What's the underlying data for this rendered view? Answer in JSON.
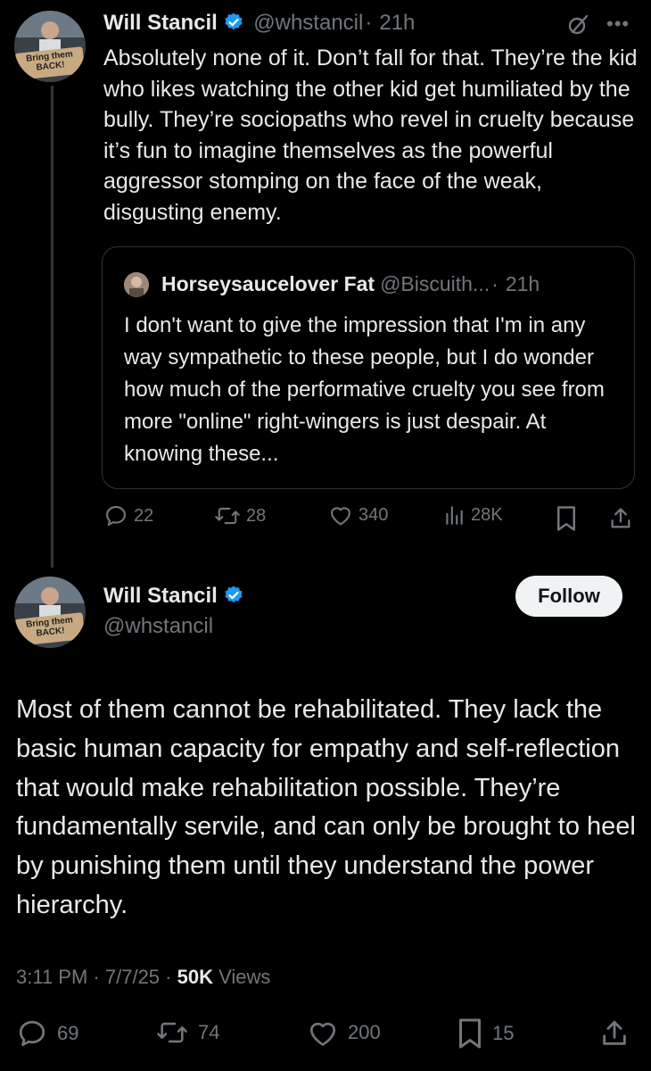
{
  "colors": {
    "verified": "#1d9bf0",
    "muted": "#71767b",
    "text": "#e7e9ea",
    "background": "#000000"
  },
  "tweet1": {
    "name": "Will Stancil",
    "handle": "@whstancil",
    "sep": "·",
    "time": "21h",
    "avatar_sign": "Bring them BACK!",
    "body": "Absolutely none of it. Don’t fall for that. They’re the kid who likes watching the other kid get humiliated by the bully. They’re sociopaths who revel in cruelty because it’s fun to imagine themselves as the powerful aggressor stomping on the face of the weak, disgusting enemy.",
    "quote": {
      "name": "Horseysaucelover Fat",
      "handle": "@Biscuith...",
      "sep": "·",
      "time": "21h",
      "body": "I don't want to give the impression that I'm in any way sympathetic to these people, but I do wonder how much of the performative cruelty you see from more \"online\" right-wingers is just despair.  At knowing these..."
    },
    "actions": {
      "replies": "22",
      "reposts": "28",
      "likes": "340",
      "views": "28K"
    }
  },
  "tweet2": {
    "name": "Will Stancil",
    "handle": "@whstancil",
    "avatar_sign": "Bring them BACK!",
    "follow_label": "Follow",
    "body": "Most of them cannot be rehabilitated. They lack the basic human capacity for empathy and self-reflection that would make rehabilitation possible. They’re fundamentally servile, and can only be brought to heel by punishing them until they understand the power hierarchy.",
    "time": "3:11 PM",
    "date": "7/7/25",
    "views_count": "50K",
    "views_label": "Views",
    "actions": {
      "replies": "69",
      "reposts": "74",
      "likes": "200",
      "bookmarks": "15"
    }
  }
}
